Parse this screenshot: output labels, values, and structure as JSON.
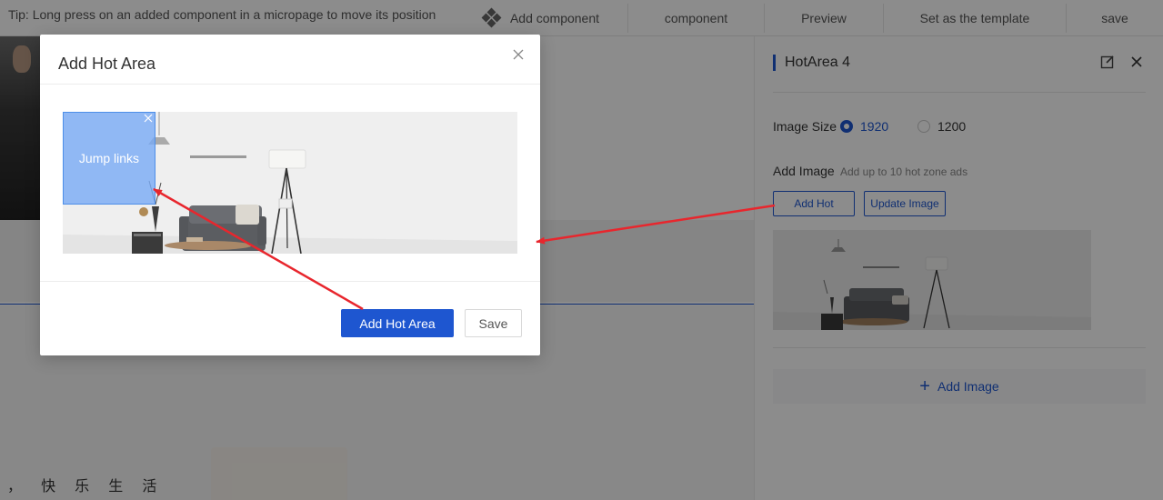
{
  "topbar": {
    "tip": "Tip: Long press on an added component in a micropage to move its position",
    "add_component": "Add component",
    "component": "component",
    "preview": "Preview",
    "set_template": "Set as the template",
    "save": "save"
  },
  "canvas": {
    "slogan": "， 快 乐 生 活"
  },
  "panel": {
    "title": "HotArea 4",
    "image_size_label": "Image Size",
    "size_options": [
      "1920",
      "1200"
    ],
    "selected_size": "1920",
    "add_image_label": "Add Image",
    "add_image_hint": "Add up to 10 hot zone ads",
    "add_hot_button": "Add Hot",
    "update_image_button": "Update Image",
    "add_image_bar": "Add Image"
  },
  "modal": {
    "title": "Add Hot Area",
    "hot_area_label": "Jump links",
    "add_hot_area_button": "Add Hot Area",
    "save_button": "Save"
  },
  "colors": {
    "accent": "#1e56d0",
    "annotation_arrow": "#e8262d",
    "hot_area_fill": "#78aaf5"
  }
}
